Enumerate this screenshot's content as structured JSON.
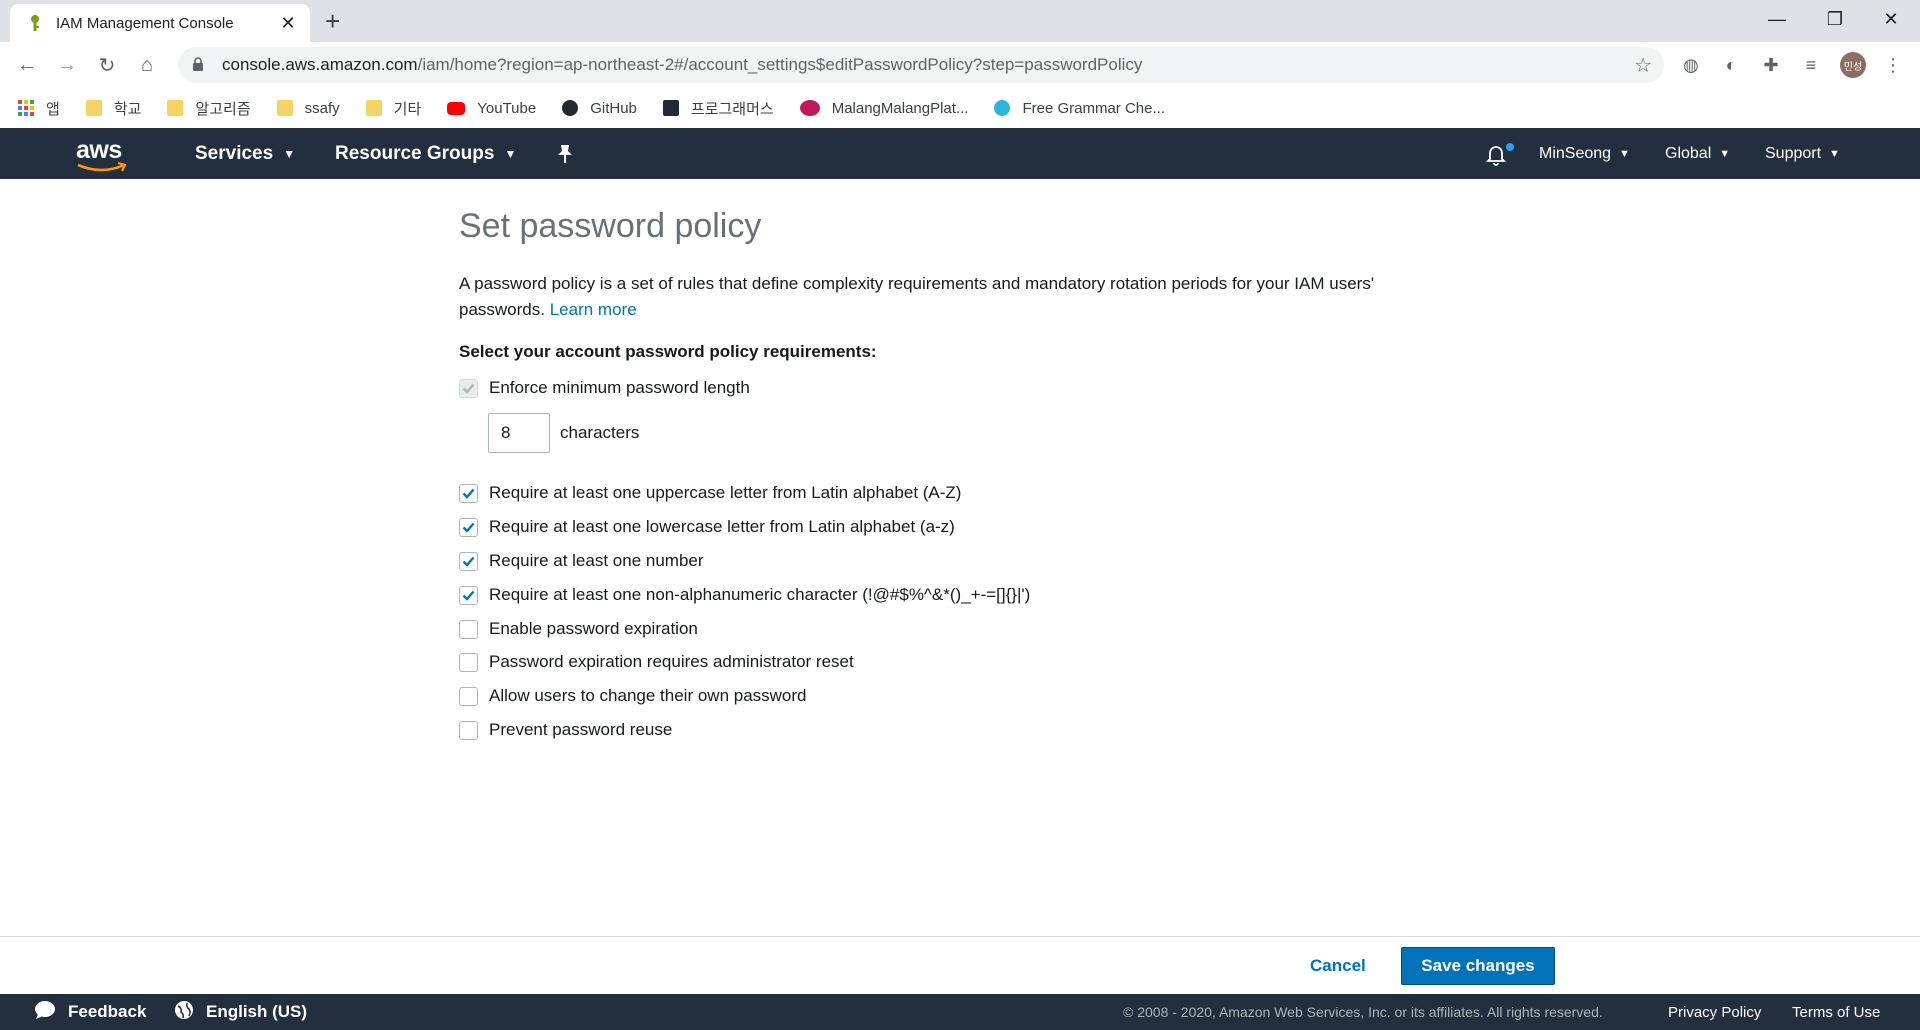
{
  "browser": {
    "tab_title": "IAM Management Console",
    "url_host": "console.aws.amazon.com",
    "url_path": "/iam/home?region=ap-northeast-2#/account_settings$editPasswordPolicy?step=passwordPolicy",
    "profile_label": "민성",
    "bookmarks": [
      {
        "label": "앱",
        "icon": "apps-icon"
      },
      {
        "label": "학교",
        "icon": "folder-icon"
      },
      {
        "label": "알고리즘",
        "icon": "folder-icon"
      },
      {
        "label": "ssafy",
        "icon": "folder-icon"
      },
      {
        "label": "기타",
        "icon": "folder-icon"
      },
      {
        "label": "YouTube",
        "icon": "youtube-icon"
      },
      {
        "label": "GitHub",
        "icon": "github-icon"
      },
      {
        "label": "프로그래머스",
        "icon": "programmers-icon"
      },
      {
        "label": "MalangMalangPlat...",
        "icon": "malang-icon"
      },
      {
        "label": "Free Grammar Che...",
        "icon": "grammar-icon"
      }
    ]
  },
  "awsnav": {
    "logo": "aws",
    "services": "Services",
    "resource_groups": "Resource Groups",
    "user": "MinSeong",
    "region": "Global",
    "support": "Support"
  },
  "page": {
    "title": "Set password policy",
    "intro": "A password policy is a set of rules that define complexity requirements and mandatory rotation periods for your IAM users' passwords.",
    "learn_more": "Learn more",
    "section_label": "Select your account password policy requirements:",
    "min_length": {
      "label": "Enforce minimum password length",
      "checked": true,
      "value": "8",
      "unit": "characters"
    },
    "options": [
      {
        "label": "Require at least one uppercase letter from Latin alphabet (A-Z)",
        "checked": true
      },
      {
        "label": "Require at least one lowercase letter from Latin alphabet (a-z)",
        "checked": true
      },
      {
        "label": "Require at least one number",
        "checked": true
      },
      {
        "label": "Require at least one non-alphanumeric character (!@#$%^&*()_+-=[]{}|')",
        "checked": true
      },
      {
        "label": "Enable password expiration",
        "checked": false
      },
      {
        "label": "Password expiration requires administrator reset",
        "checked": false
      },
      {
        "label": "Allow users to change their own password",
        "checked": false
      },
      {
        "label": "Prevent password reuse",
        "checked": false
      }
    ],
    "cancel": "Cancel",
    "save": "Save changes"
  },
  "footer": {
    "feedback": "Feedback",
    "language": "English (US)",
    "copyright": "© 2008 - 2020, Amazon Web Services, Inc. or its affiliates. All rights reserved.",
    "privacy": "Privacy Policy",
    "terms": "Terms of Use"
  },
  "colors": {
    "aws_nav": "#232f3e",
    "link": "#0073bb",
    "primary_button": "#0073bb",
    "aws_orange": "#ff9900"
  }
}
